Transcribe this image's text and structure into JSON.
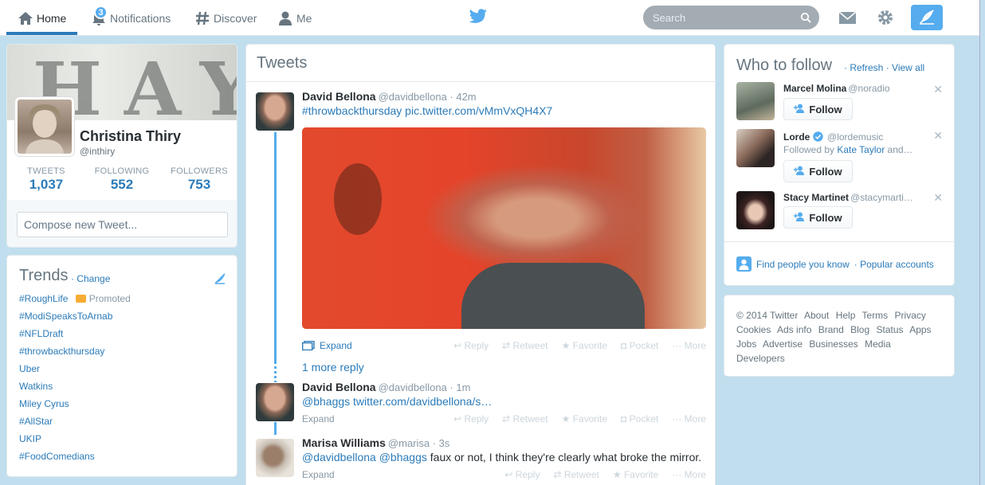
{
  "nav": {
    "home": "Home",
    "notifications": "Notifications",
    "notifications_count": "3",
    "discover": "Discover",
    "me": "Me",
    "search_placeholder": "Search"
  },
  "colors": {
    "accent": "#55acee",
    "link": "#2b7bb9",
    "background": "#c0deed"
  },
  "profile": {
    "banner_text": "HAY",
    "name": "Christina Thiry",
    "handle": "@inthiry",
    "stats": [
      {
        "label": "TWEETS",
        "value": "1,037"
      },
      {
        "label": "FOLLOWING",
        "value": "552"
      },
      {
        "label": "FOLLOWERS",
        "value": "753"
      }
    ],
    "compose_placeholder": "Compose new Tweet..."
  },
  "trends": {
    "title": "Trends",
    "change": "· Change",
    "items": [
      "#RoughLife",
      "#ModiSpeaksToArnab",
      "#NFLDraft",
      "#throwbackthursday",
      "Uber",
      "Watkins",
      "Miley Cyrus",
      "#AllStar",
      "UKIP",
      "#FoodComedians"
    ],
    "promoted_label": "Promoted"
  },
  "timeline": {
    "title": "Tweets",
    "tweets": [
      {
        "name": "David Bellona",
        "meta": "@davidbellona · 42m",
        "text": "#throwbackthursday pic.twitter.com/vMmVxQH4X7"
      },
      {
        "name": "David Bellona",
        "meta": "@davidbellona · 1m",
        "text": "@bhaggs twitter.com/davidbellona/s…"
      },
      {
        "name": "Marisa Williams",
        "meta": "@marisa · 3s",
        "text_mentions": "@davidbellona @bhaggs",
        "text_rest": " faux or not, I think they're clearly what broke the mirror."
      }
    ],
    "expand": "Expand",
    "more_reply": "1 more reply",
    "actions": [
      "Reply",
      "Retweet",
      "Favorite",
      "Pocket",
      "More"
    ]
  },
  "who_to_follow": {
    "title": "Who to follow",
    "refresh": "· Refresh",
    "view_all": "· View all",
    "follow_label": "Follow",
    "suggestions": [
      {
        "name": "Marcel Molina",
        "handle": "@noradio",
        "sub": ""
      },
      {
        "name": "Lorde",
        "handle": "@lordemusic",
        "sub_prefix": "Followed by ",
        "sub_link": "Kate Taylor",
        "sub_suffix": " and…"
      },
      {
        "name": "Stacy Martinet",
        "handle": "@stacymarti…",
        "sub": ""
      }
    ],
    "find_people": "Find people you know",
    "popular": "· Popular accounts"
  },
  "footer": {
    "links": [
      "© 2014 Twitter",
      "About",
      "Help",
      "Terms",
      "Privacy",
      "Cookies",
      "Ads info",
      "Brand",
      "Blog",
      "Status",
      "Apps",
      "Jobs",
      "Advertise",
      "Businesses",
      "Media",
      "Developers"
    ]
  }
}
